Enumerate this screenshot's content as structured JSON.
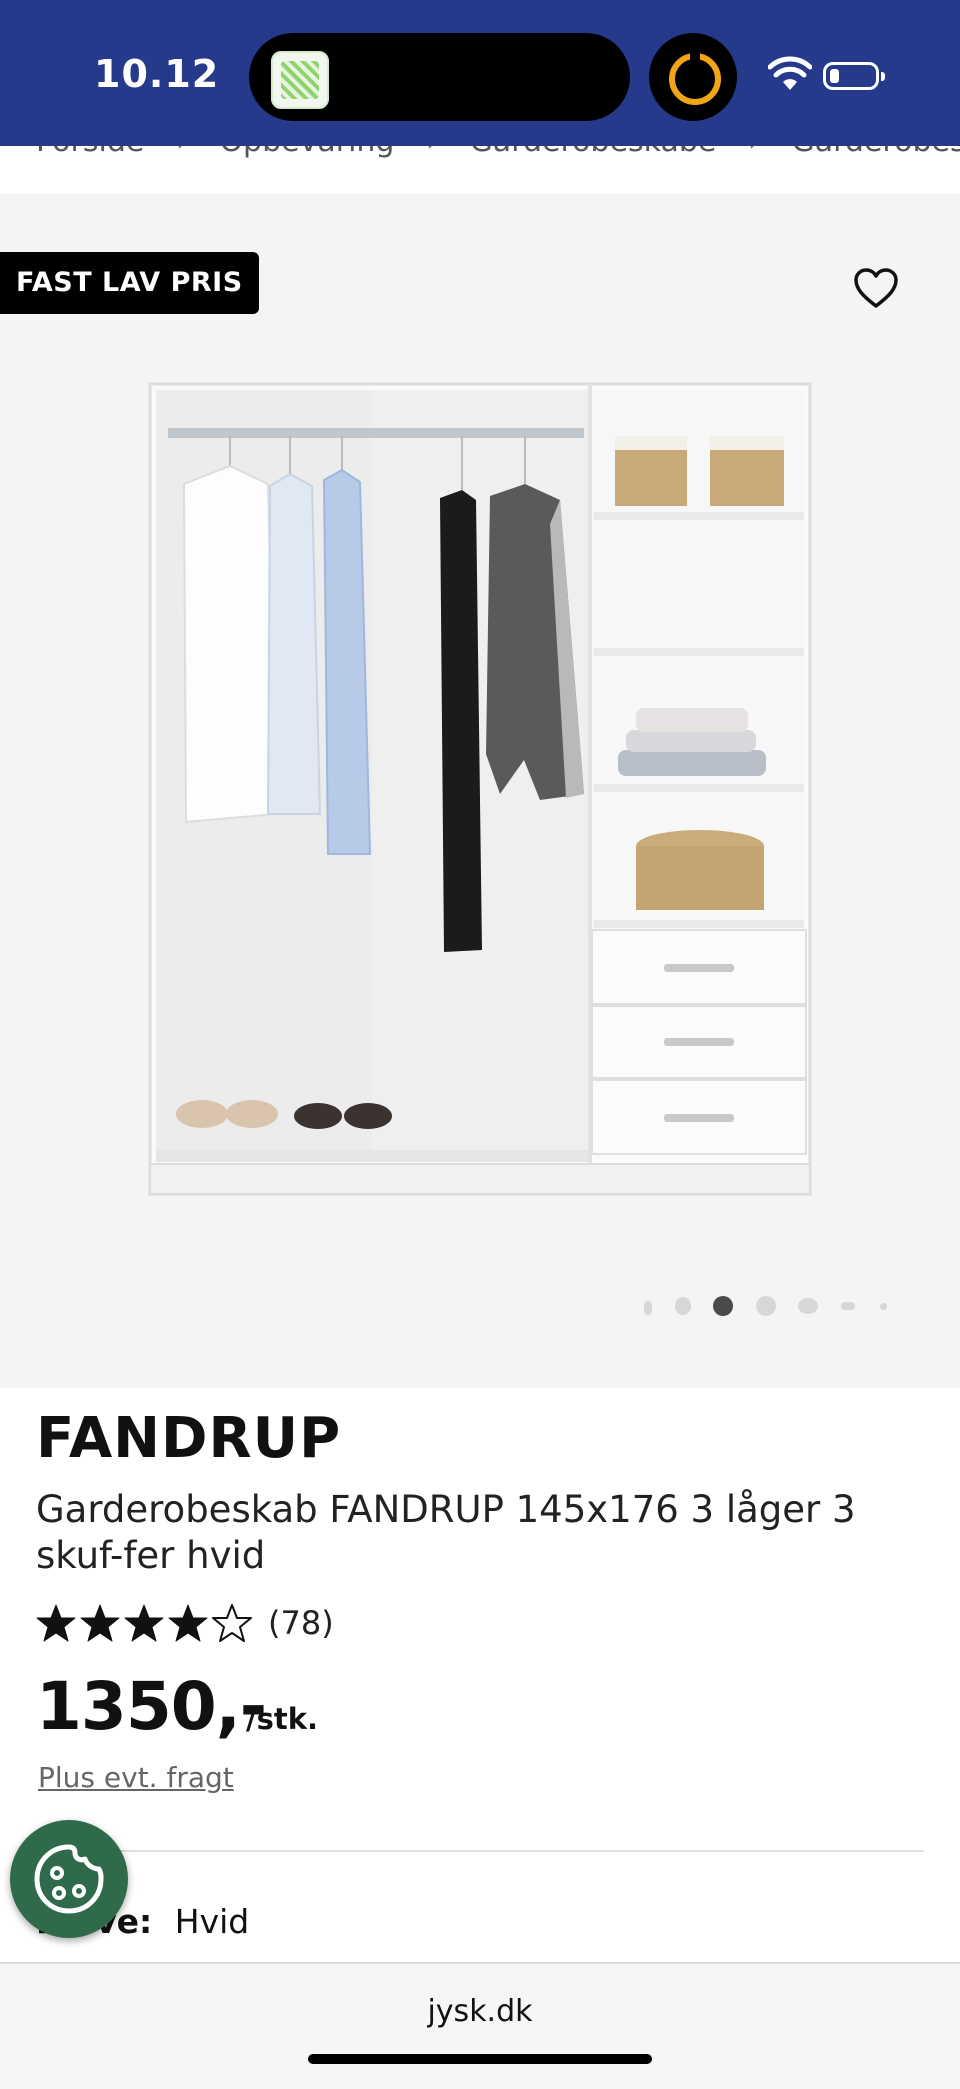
{
  "status_bar": {
    "time": "10.12",
    "island_app_icon": "notes-app-icon",
    "timer_icon": "timer-ring-icon",
    "wifi_icon": "wifi-icon",
    "battery_icon": "battery-icon",
    "battery_level": 0.2
  },
  "breadcrumb": {
    "items": [
      "Forside",
      "Opbevaring",
      "Garderobeskabe",
      "Garderobeskab FANDRUP"
    ],
    "separator": "›"
  },
  "gallery": {
    "badge": "FAST LAV PRIS",
    "favorite_icon": "heart-outline-icon",
    "image_alt": "Wardrobe with hanging clothes, shelves with baskets and three drawers",
    "dots_count": 7,
    "active_dot": 3
  },
  "product": {
    "brand": "FANDRUP",
    "name": "Garderobeskab FANDRUP 145x176 3 låger 3 skuf-fer hvid",
    "rating": 4,
    "rating_max": 5,
    "rating_count": "(78)",
    "price": "1350,-",
    "unit": "/stk.",
    "shipping_link": "Plus evt. fragt",
    "color_label": "Farve:",
    "color_value": "Hvid"
  },
  "cookie_button": {
    "icon": "cookie-icon"
  },
  "browser": {
    "domain": "jysk.dk"
  },
  "colors": {
    "status_bar_bg": "#263a8c",
    "gallery_bg": "#f4f4f4",
    "badge_bg": "#000000",
    "cookie_bg": "#2f6a4a",
    "timer_ring": "#f2a516"
  }
}
